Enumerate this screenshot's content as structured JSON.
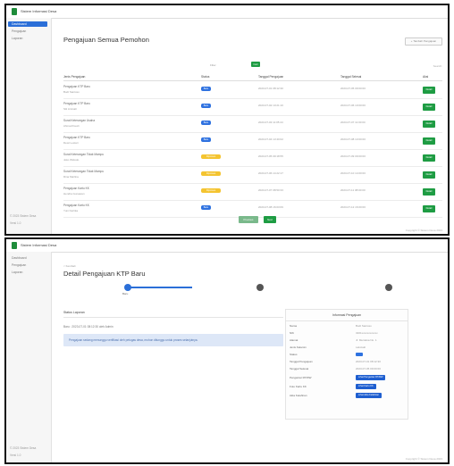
{
  "app": {
    "name": "Sistem Informasi Desa"
  },
  "sidebar": {
    "items": [
      {
        "label": "Dashboard"
      },
      {
        "label": "Pengajuan"
      },
      {
        "label": "Laporan"
      }
    ],
    "footer_lines": [
      "© 2023 Sistem Desa",
      "Versi 1.0"
    ]
  },
  "list_page": {
    "title": "Pengajuan Semua Pemohon",
    "top_button": "+ Tambah Pengajuan",
    "filter_label": "Filter",
    "filter_button": "Cari",
    "search_label": "Search:",
    "columns": [
      "Jenis Pengajuan",
      "Status",
      "Tanggal Pengajuan",
      "Tanggal Selesai",
      "Aksi"
    ],
    "rows": [
      {
        "name": "Pengajuan KTP Baru",
        "sub": "Budi Santoso",
        "status": "Baru",
        "status_color": "#2f72e0",
        "date1": "2023-07-01 08:12:30",
        "date2": "2023-07-05 09:00:00",
        "action": "Detail"
      },
      {
        "name": "Pengajuan KTP Baru",
        "sub": "Siti Aminah",
        "status": "Baru",
        "status_color": "#2f72e0",
        "date1": "2023-07-02 10:21:10",
        "date2": "2023-07-06 10:00:00",
        "action": "Detail"
      },
      {
        "name": "Surat Keterangan Usaha",
        "sub": "Ahmad Fauzi",
        "status": "Baru",
        "status_color": "#2f72e0",
        "date1": "2023-07-03 11:05:44",
        "date2": "2023-07-07 11:00:00",
        "action": "Detail"
      },
      {
        "name": "Pengajuan KTP Baru",
        "sub": "Dewi Lestari",
        "status": "Baru",
        "status_color": "#2f72e0",
        "date1": "2023-07-04 13:40:02",
        "date2": "2023-07-08 13:00:00",
        "action": "Detail"
      },
      {
        "name": "Surat Keterangan Tidak Mampu",
        "sub": "Joko Widodo",
        "status": "Diproses",
        "status_color": "#f4c430",
        "date1": "2023-07-05 09:18:55",
        "date2": "2023-07-09 09:00:00",
        "action": "Detail"
      },
      {
        "name": "Surat Keterangan Tidak Mampu",
        "sub": "Rina Marlina",
        "status": "Diproses",
        "status_color": "#f4c430",
        "date1": "2023-07-06 14:22:17",
        "date2": "2023-07-10 14:00:00",
        "action": "Detail"
      },
      {
        "name": "Pengajuan Kartu KK",
        "sub": "Hendra Gunawan",
        "status": "Diproses",
        "status_color": "#f4c430",
        "date1": "2023-07-07 08:50:33",
        "date2": "2023-07-11 08:00:00",
        "action": "Detail"
      },
      {
        "name": "Pengajuan Kartu KK",
        "sub": "Yuni Kartika",
        "status": "Baru",
        "status_color": "#2f72e0",
        "date1": "2023-07-08 16:03:09",
        "date2": "2023-07-12 16:00:00",
        "action": "Detail"
      }
    ],
    "pager_prev": "Previous",
    "pager_next": "Next",
    "footer": "Copyright © Sistem Desa 2023"
  },
  "detail_page": {
    "breadcrumb": "< Kembali",
    "title": "Detail Pengajuan KTP Baru",
    "step_label": "Baru",
    "left_card_title": "Status Laporan",
    "left_card_line": "Baru : 2023-07-01 08:12:30 oleh Admin",
    "note": "Pengajuan sedang menunggu verifikasi oleh petugas desa, mohon ditunggu untuk proses selanjutnya.",
    "right_card_title": "Informasi Pengajuan",
    "fields": [
      {
        "label": "Nama",
        "value": "Budi Santoso"
      },
      {
        "label": "NIK",
        "value": "3201xxxxxxxxxxxx"
      },
      {
        "label": "Alamat",
        "value": "Jl. Merdeka No. 1"
      },
      {
        "label": "Jenis Kelamin",
        "value": "Laki-laki"
      },
      {
        "label": "Status",
        "value": ""
      },
      {
        "label": "Tanggal Pengajuan",
        "value": "2023-07-01 08:12:30"
      },
      {
        "label": "Tanggal Selesai",
        "value": "2023-07-05 09:00:00"
      },
      {
        "label": "Pengantar RT/RW",
        "button": "Lihat Pengantar RT/RW"
      },
      {
        "label": "Foto Kartu KK",
        "button": "Lihat Kartu KK"
      },
      {
        "label": "Akta Kelahiran",
        "button": "Lihat Akta Kelahiran"
      }
    ],
    "status_badge_color": "#2f72e0",
    "footer": "Copyright © Sistem Desa 2023"
  }
}
